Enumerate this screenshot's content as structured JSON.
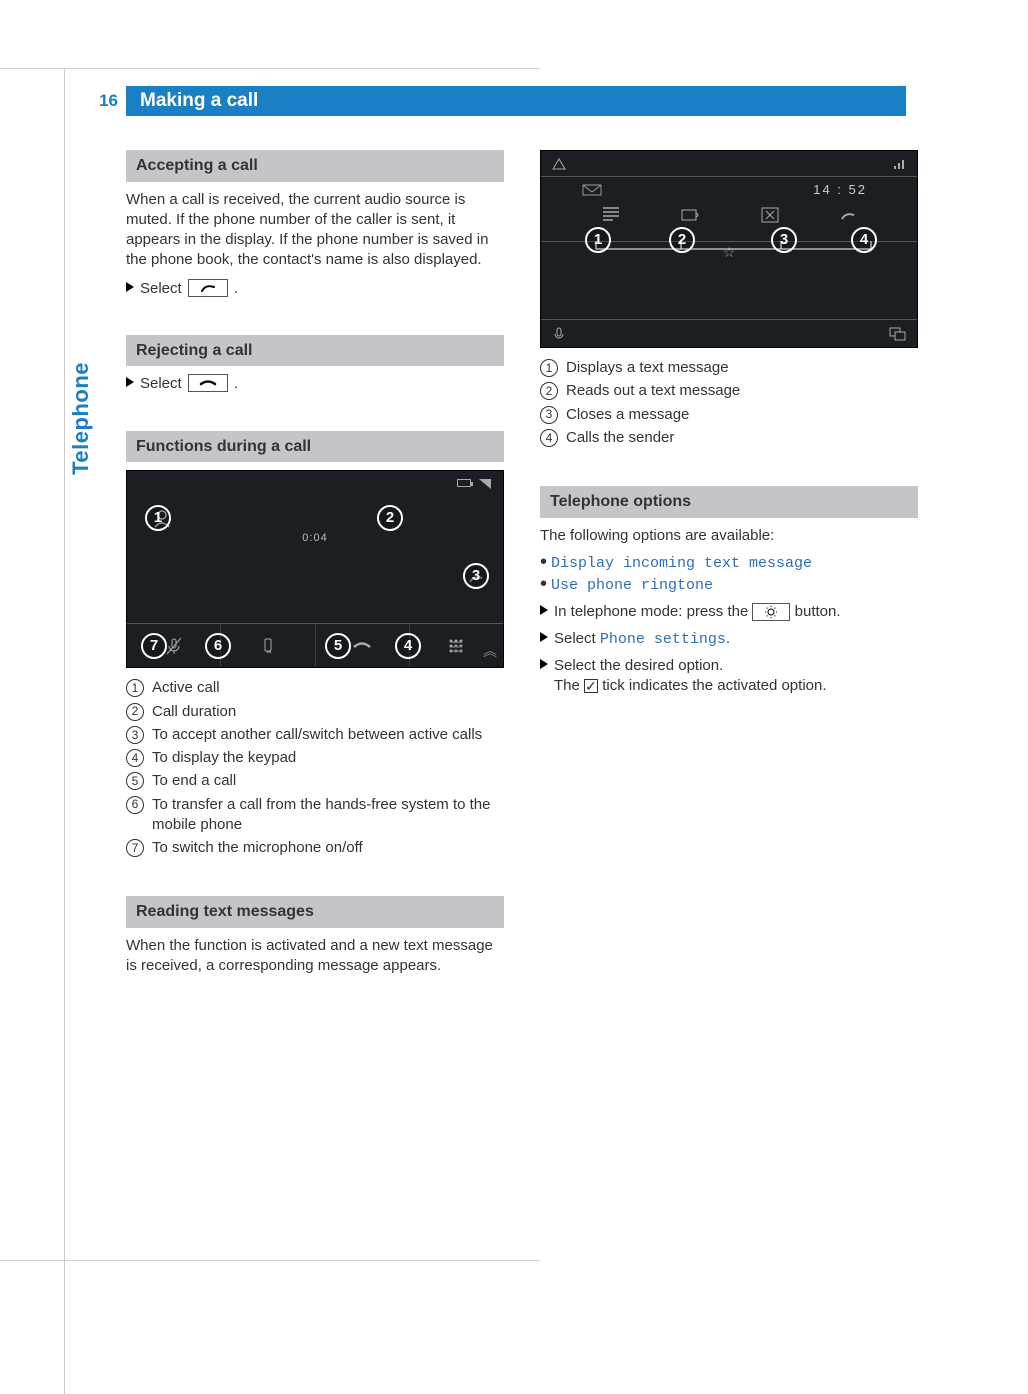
{
  "page_number": "16",
  "page_title": "Making a call",
  "side_tab": "Telephone",
  "sections": {
    "accepting": {
      "heading": "Accepting a call",
      "body": "When a call is received, the current audio source is muted. If the phone number of the caller is sent, it appears in the display. If the phone number is saved in the phone book, the contact's name is also displayed.",
      "step": "Select"
    },
    "rejecting": {
      "heading": "Rejecting a call",
      "step": "Select"
    },
    "functions": {
      "heading": "Functions during a call",
      "duration": "0:04",
      "items": {
        "1": "Active call",
        "2": "Call duration",
        "3": "To accept another call/switch between active calls",
        "4": "To display the keypad",
        "5": "To end a call",
        "6": "To transfer a call from the hands-free system to the mobile phone",
        "7": "To switch the microphone on/off"
      }
    },
    "reading": {
      "heading": "Reading text messages",
      "body": "When the function is activated and a new text message is received, a corresponding message appears."
    },
    "fig2": {
      "time": "14 : 52",
      "items": {
        "1": "Displays a text message",
        "2": "Reads out a text message",
        "3": "Closes a message",
        "4": "Calls the sender"
      }
    },
    "options": {
      "heading": "Telephone options",
      "intro": "The following options are available:",
      "opt1": "Display incoming text message",
      "opt2": "Use phone ringtone",
      "step1_a": "In telephone mode: press the",
      "step1_b": "button.",
      "step2_a": "Select",
      "step2_b": "Phone settings",
      "step3": "Select the desired option.",
      "step3b_a": "The",
      "step3b_b": "tick indicates the activated option."
    }
  }
}
